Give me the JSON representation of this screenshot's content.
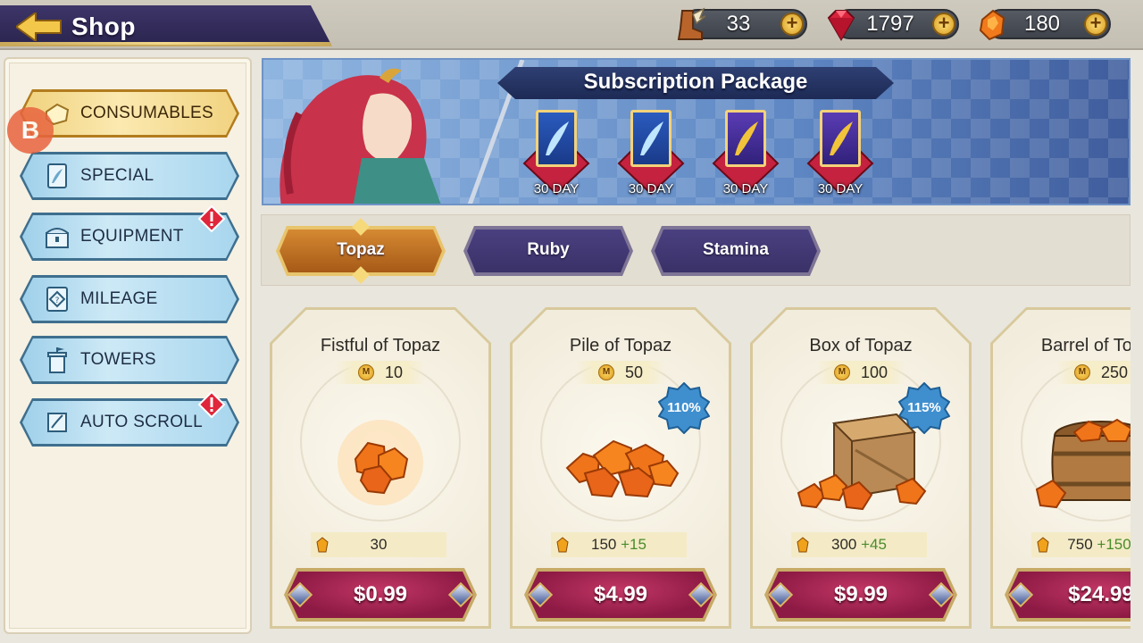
{
  "header": {
    "title": "Shop",
    "currencies": [
      {
        "icon": "winged-boot-icon",
        "value": "33"
      },
      {
        "icon": "ruby-icon",
        "value": "1797"
      },
      {
        "icon": "topaz-icon",
        "value": "180"
      }
    ]
  },
  "sidebar": {
    "items": [
      {
        "label": "CONSUMABLES",
        "icon": "consumables-icon",
        "active": true,
        "alert": false
      },
      {
        "label": "SPECIAL",
        "icon": "feather-card-icon",
        "active": false,
        "alert": false
      },
      {
        "label": "EQUIPMENT",
        "icon": "chest-icon",
        "active": false,
        "alert": true
      },
      {
        "label": "MILEAGE",
        "icon": "mileage-icon",
        "active": false,
        "alert": false
      },
      {
        "label": "TOWERS",
        "icon": "tower-icon",
        "active": false,
        "alert": false
      },
      {
        "label": "AUTO SCROLL",
        "icon": "scroll-icon",
        "active": false,
        "alert": true
      }
    ],
    "overlay_badge": "B"
  },
  "banner": {
    "title": "Subscription Package",
    "packages": [
      {
        "label": "30 DAY",
        "card": "blue"
      },
      {
        "label": "30 DAY",
        "card": "blue"
      },
      {
        "label": "30 DAY",
        "card": "purple"
      },
      {
        "label": "30 DAY",
        "card": "purple"
      }
    ]
  },
  "tabs": [
    {
      "label": "Topaz",
      "active": true
    },
    {
      "label": "Ruby",
      "active": false
    },
    {
      "label": "Stamina",
      "active": false
    }
  ],
  "products": [
    {
      "name": "Fistful of Topaz",
      "mileage_icon": "M",
      "mileage": "10",
      "bonus_badge": "",
      "amount": "30",
      "bonus": "",
      "price": "$0.99",
      "art": "topaz-fistful-icon"
    },
    {
      "name": "Pile of Topaz",
      "mileage_icon": "M",
      "mileage": "50",
      "bonus_badge": "110%",
      "amount": "150",
      "bonus": "+15",
      "price": "$4.99",
      "art": "topaz-pile-icon"
    },
    {
      "name": "Box of Topaz",
      "mileage_icon": "M",
      "mileage": "100",
      "bonus_badge": "115%",
      "amount": "300",
      "bonus": "+45",
      "price": "$9.99",
      "art": "topaz-box-icon"
    },
    {
      "name": "Barrel of Topaz",
      "mileage_icon": "M",
      "mileage": "250",
      "bonus_badge": "",
      "amount": "750",
      "bonus": "+150",
      "price": "$24.99",
      "art": "topaz-barrel-icon"
    }
  ],
  "colors": {
    "active_category": "#f0d27e",
    "category": "#a8d6ee",
    "active_tab": "#d58a32",
    "tab": "#4a4080",
    "price_button": "#a3234f",
    "bonus_text": "#4a8b2c"
  }
}
